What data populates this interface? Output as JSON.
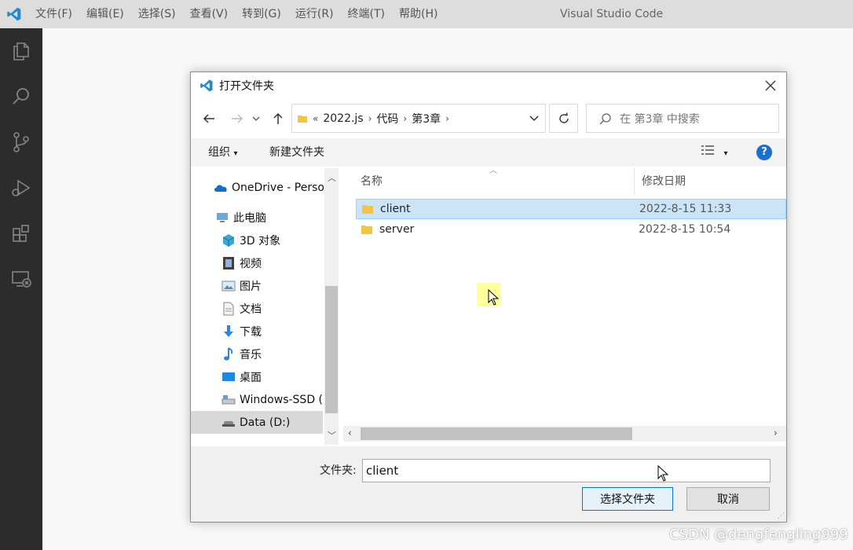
{
  "vscode": {
    "menu": [
      "文件(F)",
      "编辑(E)",
      "选择(S)",
      "查看(V)",
      "转到(G)",
      "运行(R)",
      "终端(T)",
      "帮助(H)"
    ],
    "window_title": "Visual Studio Code",
    "activity_icons": [
      "explorer-icon",
      "search-icon",
      "source-control-icon",
      "run-debug-icon",
      "extensions-icon",
      "remote-explorer-icon"
    ]
  },
  "dialog": {
    "title": "打开文件夹",
    "address": {
      "prefix": "«",
      "segments": [
        "2022.js",
        "代码",
        "第3章"
      ]
    },
    "search_placeholder": "在 第3章 中搜索",
    "toolbar": {
      "organize": "组织",
      "new_folder": "新建文件夹"
    },
    "nav_pane": {
      "items": [
        {
          "label": "OneDrive - Perso",
          "icon": "onedrive-icon"
        },
        {
          "label": "此电脑",
          "icon": "this-pc-icon"
        },
        {
          "label": "3D 对象",
          "icon": "3d-objects-icon"
        },
        {
          "label": "视频",
          "icon": "videos-icon"
        },
        {
          "label": "图片",
          "icon": "pictures-icon"
        },
        {
          "label": "文档",
          "icon": "documents-icon"
        },
        {
          "label": "下载",
          "icon": "downloads-icon"
        },
        {
          "label": "音乐",
          "icon": "music-icon"
        },
        {
          "label": "桌面",
          "icon": "desktop-icon"
        },
        {
          "label": "Windows-SSD (",
          "icon": "drive-icon"
        },
        {
          "label": "Data (D:)",
          "icon": "drive-icon",
          "selected": true
        }
      ]
    },
    "columns": {
      "name": "名称",
      "modified": "修改日期"
    },
    "files": [
      {
        "name": "client",
        "modified": "2022-8-15 11:33",
        "selected": true
      },
      {
        "name": "server",
        "modified": "2022-8-15 10:54",
        "selected": false
      }
    ],
    "folder_label": "文件夹:",
    "folder_value": "client",
    "select_button": "选择文件夹",
    "cancel_button": "取消"
  },
  "watermark": "CSDN @dengfengling999",
  "colors": {
    "vscode_blue": "#2489ca",
    "selection_bg": "#cce4f7",
    "folder_yellow": "#f4c542",
    "help_blue": "#1c6fd1"
  }
}
